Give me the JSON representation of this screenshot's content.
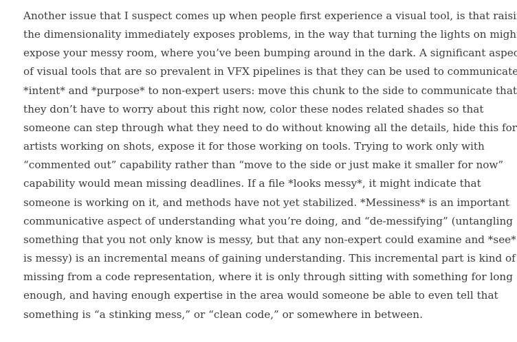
{
  "article": {
    "paragraph_lines": [
      "Another issue that I suspect comes up when people first experience a visual tool, is that raising",
      "the dimensionality immediately exposes problems, in the way that turning the lights on might",
      "expose your messy room, where you’ve been bumping around in the dark. A significant aspect",
      "of visual tools that are so prevalent in VFX pipelines is that they can be used to communicate",
      "*intent* and *purpose* to non-expert users: move this chunk to the side to communicate that",
      "they don’t have to worry about this right now, color these nodes related shades so that",
      "someone can step through what they need to do without knowing all the details, hide this for",
      "artists working on shots, expose it for those working on tools. Trying to work only with",
      "“commented out” capability rather than “move to the side or just make it smaller for now”",
      "capability would mean missing deadlines. If a file *looks messy*, it might indicate that",
      "someone is working on it, and methods have not yet stabilized. *Messiness* is an important",
      "communicative aspect of understanding what you’re doing, and “de-messifying” (untangling",
      "something that you not only know is messy, but that any non-expert could examine and *see*",
      "is messy) is an incremental means of gaining understanding. This incremental part is kind of",
      "missing from a code representation, where it is only through sitting with something for long",
      "enough, and having enough expertise in the area would someone be able to even tell that",
      "something is “a stinking mess,” or “clean code,” or somewhere in between."
    ]
  }
}
